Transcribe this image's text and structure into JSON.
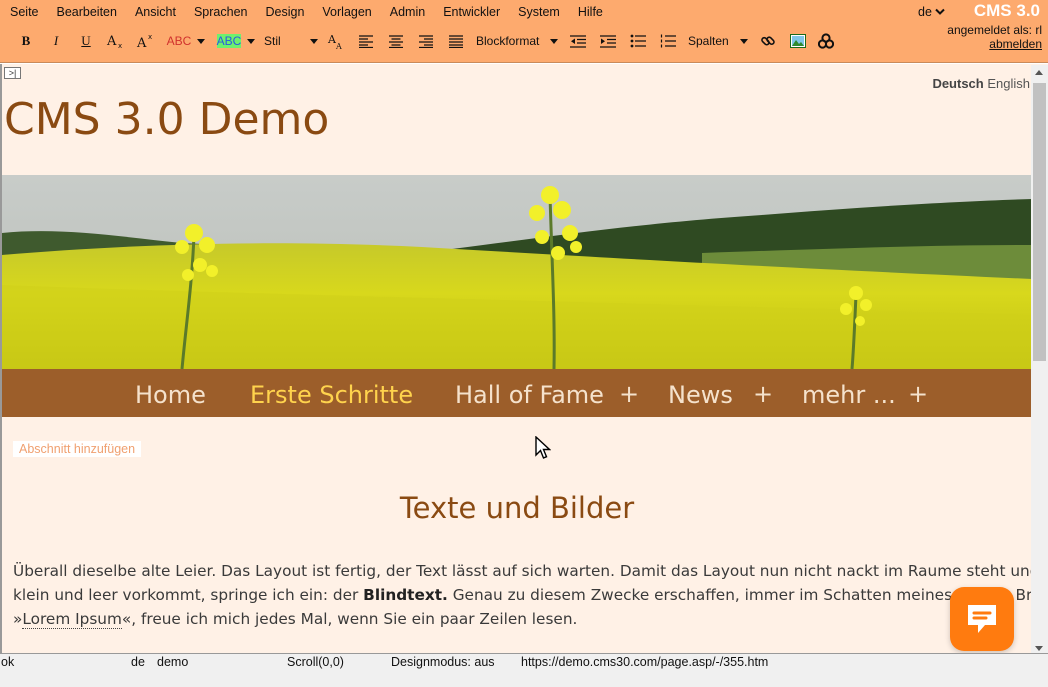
{
  "colors": {
    "chrome_bg": "#fdaa6e",
    "canvas_bg": "#fff1e6",
    "title_brown": "#8a4a12",
    "nav_bg": "#9c5e2a",
    "nav_active": "#ffd34d",
    "chat_orange": "#ff7b0f"
  },
  "menubar": {
    "items": [
      "Seite",
      "Bearbeiten",
      "Ansicht",
      "Sprachen",
      "Design",
      "Vorlagen",
      "Admin",
      "Entwickler",
      "System",
      "Hilfe"
    ],
    "language": "de",
    "brand": "CMS 3.0",
    "login_label": "angemeldet als: rl",
    "logout": "abmelden"
  },
  "toolbar": {
    "bold": "B",
    "italic": "I",
    "underline": "U",
    "font_color_label": "ABC",
    "bg_color_label": "ABC",
    "style_label": "Stil",
    "blockformat_label": "Blockformat",
    "columns_label": "Spalten",
    "icons": [
      "bold-icon",
      "italic-icon",
      "underline-icon",
      "subscript-icon",
      "superscript-icon",
      "font-color-icon",
      "background-color-icon",
      "style-dropdown",
      "font-size-icon",
      "align-left-icon",
      "align-center-icon",
      "align-right-icon",
      "align-justify-icon",
      "blockformat-dropdown",
      "outdent-icon",
      "indent-icon",
      "bullet-list-icon",
      "numbered-list-icon",
      "columns-dropdown",
      "link-icon",
      "image-icon",
      "plugin-icon"
    ]
  },
  "page": {
    "lang_current": "Deutsch",
    "lang_other": "English",
    "site_title": "CMS 3.0 Demo",
    "nav": [
      {
        "label": "Home",
        "active": false,
        "has_sub": false
      },
      {
        "label": "Erste Schritte",
        "active": true,
        "has_sub": false
      },
      {
        "label": "Hall of Fame",
        "active": false,
        "has_sub": true
      },
      {
        "label": "News",
        "active": false,
        "has_sub": true
      },
      {
        "label": "mehr ...",
        "active": false,
        "has_sub": true
      }
    ],
    "nav_plus": "+",
    "add_section": "Abschnitt hinzufügen",
    "heading": "Texte und Bilder",
    "para_line1": "Überall dieselbe alte Leier. Das Layout ist fertig, der Text lässt auf sich warten. Damit das Layout nun nicht nackt im Raume steht und sich",
    "para_line2_a": "klein und leer vorkommt, springe ich ein: der ",
    "para_line2_bold": "Blindtext.",
    "para_line2_b": " Genau zu diesem Zwecke erschaffen, immer im Schatten meines großen Bru",
    "para_line3_a": "»",
    "para_line3_link": "Lorem Ipsum",
    "para_line3_b": "«, freue ich mich jedes Mal, wenn Sie ein paar Zeilen lesen."
  },
  "statusbar": {
    "state": "ok",
    "lang": "de",
    "site": "demo",
    "scroll": "Scroll(0,0)",
    "design_mode": "Designmodus: aus",
    "url": "https://demo.cms30.com/page.asp/-/355.htm"
  }
}
